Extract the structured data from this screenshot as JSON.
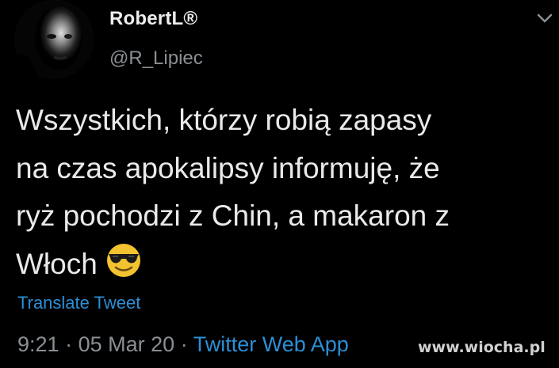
{
  "user": {
    "display_name": "RobertL®",
    "handle": "@R_Lipiec",
    "avatar_icon": "user-avatar-photo"
  },
  "menu_icon": "chevron-down-icon",
  "tweet": {
    "text": "Wszystkich, którzy robią zapasy\nna czas apokalipsy informuję, że\nryż pochodzi z Chin, a makaron z\nWłoch",
    "emoji": "smiling-face-with-sunglasses-emoji"
  },
  "translate_label": "Translate Tweet",
  "meta": {
    "time": "9:21",
    "separator": "·",
    "date": "05 Mar 20",
    "source": "Twitter Web App"
  },
  "watermark": "www.wiocha.pl",
  "colors": {
    "background": "#000000",
    "text": "#e9e9e9",
    "secondary": "#8a8f94",
    "link": "#2b8fd6"
  }
}
